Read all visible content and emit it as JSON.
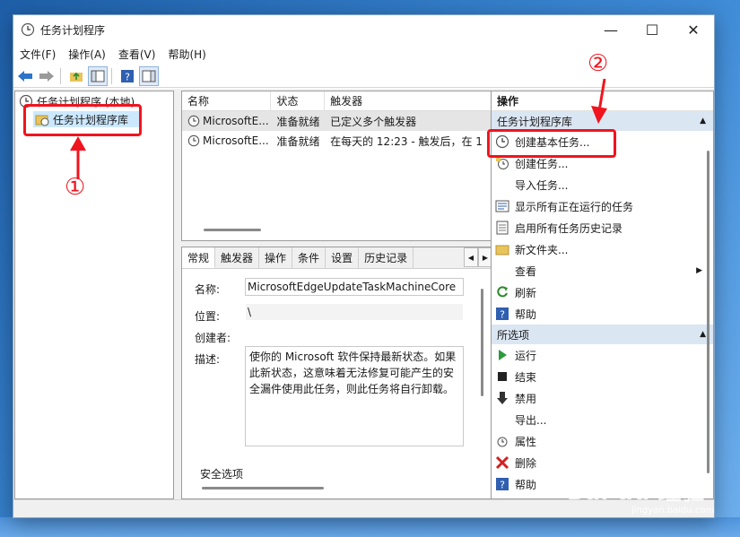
{
  "window": {
    "title": "任务计划程序"
  },
  "menu": [
    "文件(F)",
    "操作(A)",
    "查看(V)",
    "帮助(H)"
  ],
  "tree": {
    "root": "任务计划程序 (本地)",
    "child": "任务计划程序库"
  },
  "list": {
    "columns": [
      "名称",
      "状态",
      "触发器"
    ],
    "rows": [
      {
        "name": "MicrosoftE...",
        "status": "准备就绪",
        "trigger": "已定义多个触发器"
      },
      {
        "name": "MicrosoftE...",
        "status": "准备就绪",
        "trigger": "在每天的 12:23 - 触发后，在 1"
      }
    ]
  },
  "tabs": [
    "常规",
    "触发器",
    "操作",
    "条件",
    "设置",
    "历史记录"
  ],
  "details": {
    "name_label": "名称:",
    "name_value": "MicrosoftEdgeUpdateTaskMachineCore",
    "location_label": "位置:",
    "location_value": "\\",
    "author_label": "创建者:",
    "desc_label": "描述:",
    "desc_value": "使你的 Microsoft 软件保持最新状态。如果此新状态，这意味着无法修复可能产生的安全漏件使用此任务，则此任务将自行卸载。",
    "security_label": "安全选项"
  },
  "actions": {
    "title": "操作",
    "section1": "任务计划程序库",
    "items1": [
      {
        "label": "创建基本任务...",
        "icon": "create-basic-task-icon"
      },
      {
        "label": "创建任务...",
        "icon": "create-task-icon"
      },
      {
        "label": "导入任务...",
        "icon": ""
      },
      {
        "label": "显示所有正在运行的任务",
        "icon": "running-tasks-icon"
      },
      {
        "label": "启用所有任务历史记录",
        "icon": "history-icon"
      },
      {
        "label": "新文件夹...",
        "icon": "folder-icon"
      },
      {
        "label": "查看",
        "icon": ""
      },
      {
        "label": "刷新",
        "icon": "refresh-icon"
      },
      {
        "label": "帮助",
        "icon": "help-icon"
      }
    ],
    "section2": "所选项",
    "items2": [
      {
        "label": "运行",
        "icon": "run-icon"
      },
      {
        "label": "结束",
        "icon": "stop-icon"
      },
      {
        "label": "禁用",
        "icon": "disable-icon"
      },
      {
        "label": "导出...",
        "icon": ""
      },
      {
        "label": "属性",
        "icon": "properties-icon"
      },
      {
        "label": "删除",
        "icon": "delete-icon"
      },
      {
        "label": "帮助",
        "icon": "help-icon"
      }
    ]
  },
  "annotations": {
    "marker1": "①",
    "marker2": "②"
  },
  "watermark": {
    "main": "Bai du 经验",
    "sub": "jingyan.baidu.com"
  },
  "colors": {
    "highlight": "#f0141e",
    "section_bg": "#dbe6f3",
    "selection": "#cce8ff"
  }
}
